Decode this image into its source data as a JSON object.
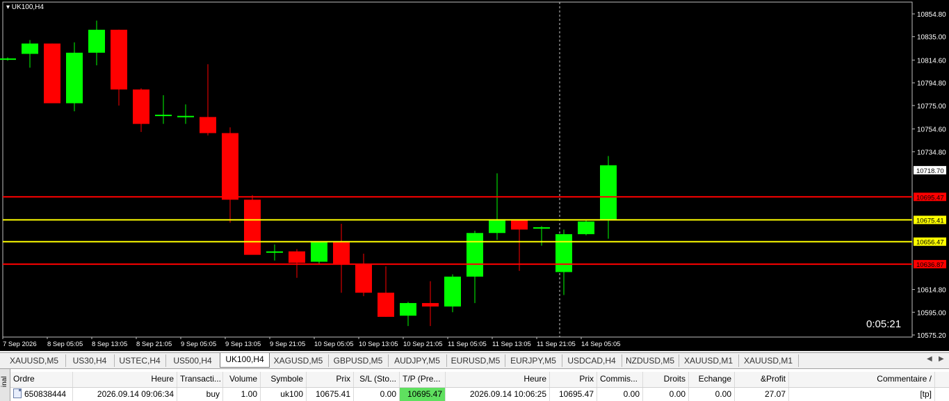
{
  "chart": {
    "title": "UK100,H4",
    "timer": "0:05:21",
    "price_levels": [
      10854.8,
      10835.0,
      10814.6,
      10794.8,
      10775.0,
      10754.6,
      10734.8,
      10595.0,
      10575.2,
      10614.8
    ],
    "price_labels": [
      "10854.80",
      "10835.00",
      "10814.60",
      "10794.80",
      "10775.00",
      "10754.60",
      "10734.80",
      "10614.80",
      "10595.00",
      "10575.20"
    ],
    "current_price_label": "10718.70",
    "hlines": [
      {
        "price": "10695.47",
        "color": "#ff0000",
        "label": "10695.47"
      },
      {
        "price": "10675.41",
        "color": "#ffff00",
        "label": "10675.41"
      },
      {
        "price": "10656.47",
        "color": "#ffff00",
        "label": "10656.47"
      },
      {
        "price": "10636.87",
        "color": "#ff0000",
        "label": "10636.87"
      }
    ],
    "time_labels": [
      "7 Sep 2026",
      "8 Sep 05:05",
      "8 Sep 13:05",
      "8 Sep 21:05",
      "9 Sep 05:05",
      "9 Sep 13:05",
      "9 Sep 21:05",
      "10 Sep 05:05",
      "10 Sep 13:05",
      "10 Sep 21:05",
      "11 Sep 05:05",
      "11 Sep 13:05",
      "11 Sep 21:05",
      "14 Sep 05:05"
    ],
    "up_color": "#00ff00",
    "down_color": "#ff0000"
  },
  "chart_data": {
    "type": "candlestick",
    "title": "UK100,H4",
    "ylim": [
      10571,
      10865
    ],
    "ohlc": [
      [
        10815,
        10817,
        10814,
        10816
      ],
      [
        10820,
        10832,
        10808,
        10829
      ],
      [
        10829,
        10829,
        10777,
        10777
      ],
      [
        10777,
        10830,
        10770,
        10821
      ],
      [
        10821,
        10849,
        10810,
        10841
      ],
      [
        10841,
        10841,
        10775,
        10789
      ],
      [
        10789,
        10790,
        10752,
        10759
      ],
      [
        10766,
        10784,
        10759,
        10767
      ],
      [
        10766,
        10776,
        10759,
        10766
      ],
      [
        10765,
        10811,
        10749,
        10751
      ],
      [
        10751,
        10756,
        10673,
        10693
      ],
      [
        10693,
        10697,
        10663,
        10645
      ],
      [
        10648,
        10654,
        10640,
        10648
      ],
      [
        10648,
        10650,
        10625,
        10638
      ],
      [
        10639,
        10656,
        10637,
        10656
      ],
      [
        10656,
        10672,
        10612,
        10637
      ],
      [
        10637,
        10646,
        10609,
        10612
      ],
      [
        10612,
        10635,
        10591,
        10591
      ],
      [
        10592,
        10604,
        10583,
        10603
      ],
      [
        10603,
        10622,
        10583,
        10600
      ],
      [
        10600,
        10628,
        10595,
        10626
      ],
      [
        10626,
        10666,
        10603,
        10664
      ],
      [
        10664,
        10716,
        10658,
        10676
      ],
      [
        10676,
        10676,
        10631,
        10667
      ],
      [
        10668,
        10670,
        10653,
        10669
      ],
      [
        10630,
        10667,
        10610,
        10663
      ],
      [
        10663,
        10676,
        10662,
        10674
      ],
      [
        10676,
        10731,
        10659,
        10723
      ]
    ]
  },
  "tabs": {
    "items": [
      "XAUUSD,M5",
      "US30,H4",
      "USTEC,H4",
      "US500,H4",
      "UK100,H4",
      "XAGUSD,M5",
      "GBPUSD,M5",
      "AUDJPY,M5",
      "EURUSD,M5",
      "EURJPY,M5",
      "USDCAD,H4",
      "NZDUSD,M5",
      "XAUUSD,M1",
      "XAUUSD,M1"
    ],
    "active_index": 4
  },
  "terminal": {
    "side_label": "inal",
    "columns": [
      "Ordre",
      "Heure",
      "Transacti...",
      "Volume",
      "Symbole",
      "Prix",
      "S/L (Sto...",
      "T/P (Pre...",
      "Heure",
      "Prix",
      "Commis...",
      "Droits",
      "Echange",
      "&Profit",
      "Commentaire"
    ],
    "row": [
      "650838444",
      "2026.09.14 09:06:34",
      "buy",
      "1.00",
      "uk100",
      "10675.41",
      "0.00",
      "10695.47",
      "2026.09.14 10:06:25",
      "10695.47",
      "0.00",
      "0.00",
      "0.00",
      "27.07",
      "[tp]"
    ]
  }
}
